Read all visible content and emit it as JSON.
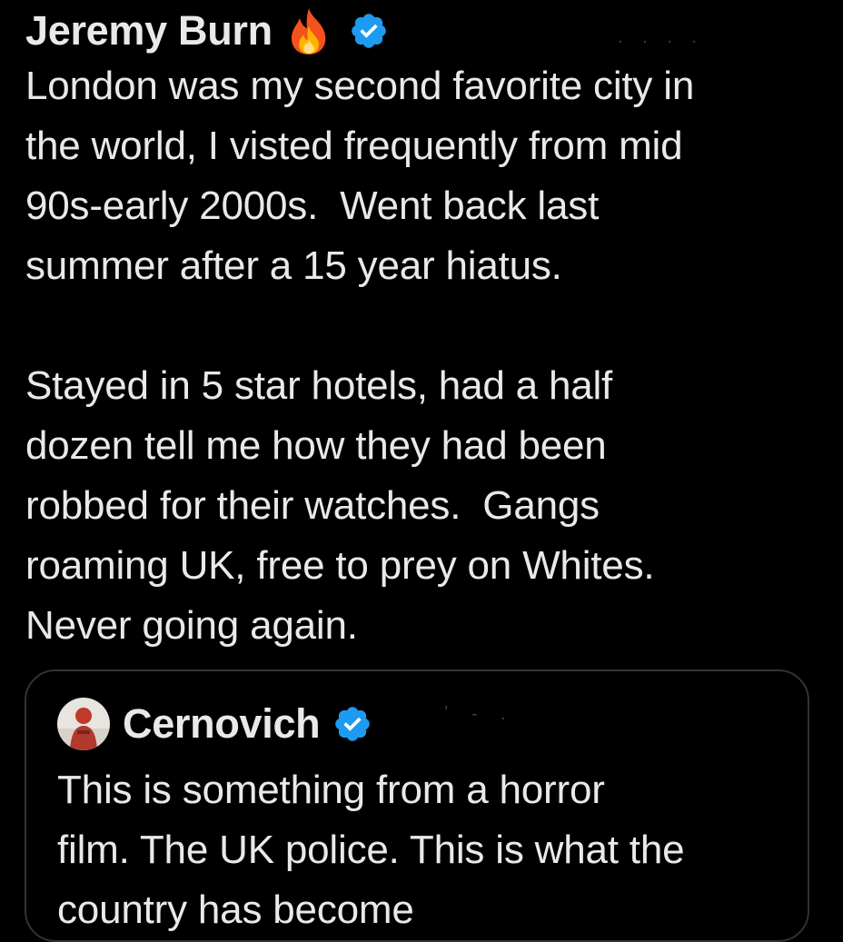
{
  "tweet": {
    "author": {
      "display_name": "Jeremy Burn",
      "name_emoji": "fire-icon",
      "verified_icon": "verified-badge-icon",
      "handle": ". . .          ."
    },
    "text": "London was my second favorite city in\nthe world, I visted frequently from mid\n90s-early 2000s.  Went back last\nsummer after a 15 year hiatus.\n\nStayed in 5 star hotels, had a half\ndozen tell me how they had been\nrobbed for their watches.  Gangs\nroaming UK, free to prey on Whites.\nNever going again."
  },
  "quote": {
    "author": {
      "display_name": "Cernovich",
      "avatar_icon": "avatar",
      "verified_icon": "verified-badge-icon",
      "handle": "ʼ   -                ."
    },
    "text": "This is something from a horror\nfilm. The UK police. This is what the\ncountry has become"
  },
  "colors": {
    "background": "#000000",
    "text": "#e7e9ea",
    "verified_blue": "#1d9bf0",
    "border": "#2f3336"
  }
}
